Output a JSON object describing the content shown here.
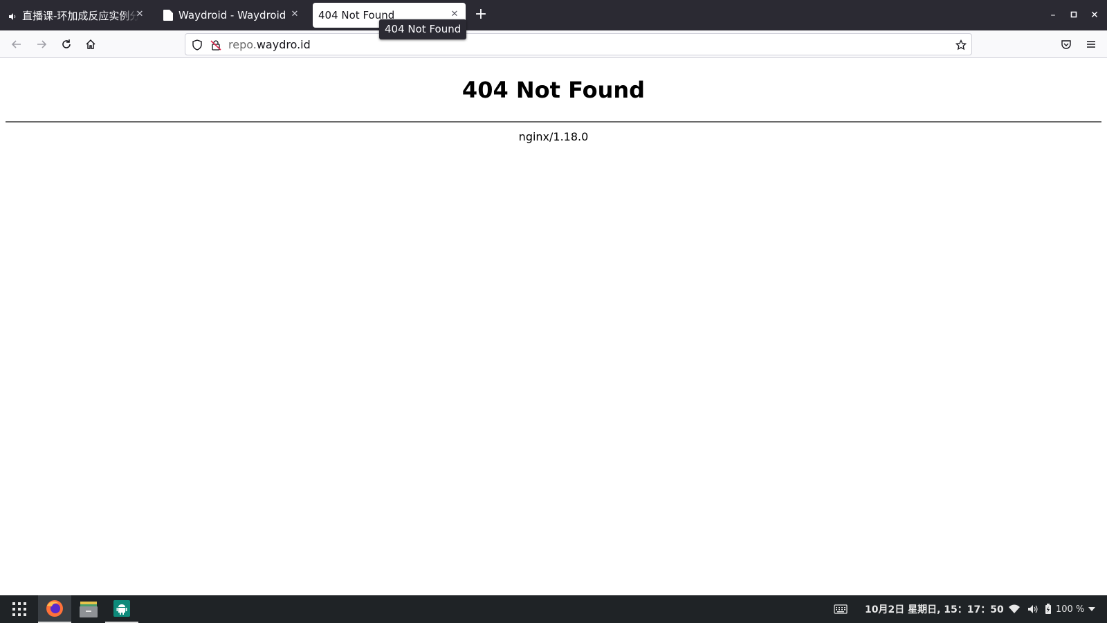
{
  "browser": {
    "tabs": [
      {
        "title": "直播课-环加成反应实例分",
        "icon": "speaker-icon",
        "active": false
      },
      {
        "title": "Waydroid - Waydroid",
        "icon": "page-icon",
        "active": false
      },
      {
        "title": "404 Not Found",
        "icon": "",
        "active": true
      }
    ],
    "tab_close_glyph": "✕",
    "new_tab_glyph": "+",
    "tooltip": "404 Not Found",
    "url_subdomain": "repo.",
    "url_domain": "waydro.id",
    "window_controls": {
      "minimize": "–",
      "maximize": "▫",
      "close": "✕"
    }
  },
  "page": {
    "heading": "404 Not Found",
    "server": "nginx/1.18.0"
  },
  "taskbar": {
    "apps": [
      {
        "name": "app-grid",
        "icon": "grid-icon"
      },
      {
        "name": "firefox",
        "icon": "firefox-icon"
      },
      {
        "name": "files",
        "icon": "files-icon"
      },
      {
        "name": "waydroid",
        "icon": "android-icon"
      }
    ],
    "clock": "10月2日 星期日, 15：17：50",
    "battery": "100 %"
  },
  "colors": {
    "tabstrip": "#2b2a33",
    "toolbar": "#f9f9fb",
    "taskbar": "#1f2326",
    "android_green": "#0e8a7a"
  }
}
